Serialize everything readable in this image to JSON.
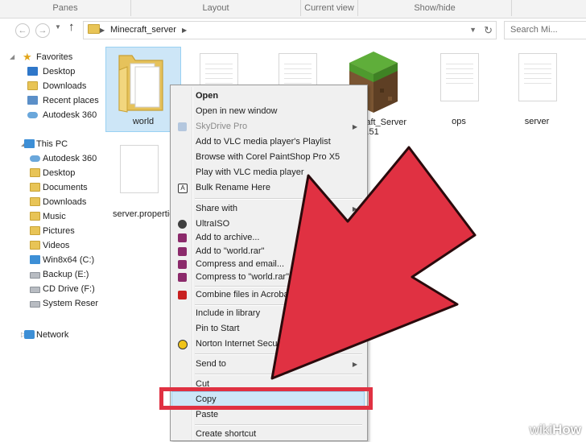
{
  "ribbon": {
    "groups": [
      "Panes",
      "Layout",
      "Current view",
      "Show/hide"
    ]
  },
  "address": {
    "path_label": "Minecraft_server",
    "search_placeholder": "Search Mi..."
  },
  "nav": {
    "favorites_header": "Favorites",
    "favorites": [
      "Desktop",
      "Downloads",
      "Recent places",
      "Autodesk 360"
    ],
    "this_pc_header": "This PC",
    "this_pc": [
      "Autodesk 360",
      "Desktop",
      "Documents",
      "Downloads",
      "Music",
      "Pictures",
      "Videos",
      "Win8x64 (C:)",
      "Backup (E:)",
      "CD Drive (F:)",
      "System Reser"
    ],
    "network_header": "Network"
  },
  "files": [
    {
      "name": "world",
      "kind": "folder"
    },
    {
      "name": "necraft_Server",
      "sub": "1.51",
      "kind": "minecraft"
    },
    {
      "name": "ops",
      "kind": "doc"
    },
    {
      "name": "server",
      "kind": "doc"
    },
    {
      "name": "server.propertie",
      "kind": "doc"
    }
  ],
  "context_menu": {
    "items": [
      {
        "label": "Open",
        "bold": true
      },
      {
        "label": "Open in new window"
      },
      {
        "label": "SkyDrive Pro",
        "submenu": true,
        "disabled": true
      },
      {
        "label": "Add to VLC media player's Playlist"
      },
      {
        "label": "Browse with Corel PaintShop Pro X5"
      },
      {
        "label": "Play with VLC media player"
      },
      {
        "label": "Bulk Rename Here"
      },
      {
        "label": "Share with",
        "submenu": true
      },
      {
        "label": "UltraISO",
        "submenu": true
      },
      {
        "label": "Add to archive..."
      },
      {
        "label": "Add to \"world.rar\""
      },
      {
        "label": "Compress and email..."
      },
      {
        "label": "Compress to \"world.rar\" a"
      },
      {
        "label": "Combine files in Acrobat..."
      },
      {
        "label": "Include in library",
        "submenu": true
      },
      {
        "label": "Pin to Start"
      },
      {
        "label": "Norton Internet Securit",
        "submenu": true
      },
      {
        "label": "Send to",
        "submenu": true
      },
      {
        "label": "Cut"
      },
      {
        "label": "Copy",
        "highlighted": true
      },
      {
        "label": "Paste"
      },
      {
        "label": "Create shortcut"
      }
    ]
  },
  "colors": {
    "accent_highlight": "#cde6f7",
    "arrow_red": "#e03142",
    "folder_yellow": "#e8c456"
  },
  "watermark": {
    "prefix": "wiki",
    "suffix": "How"
  }
}
